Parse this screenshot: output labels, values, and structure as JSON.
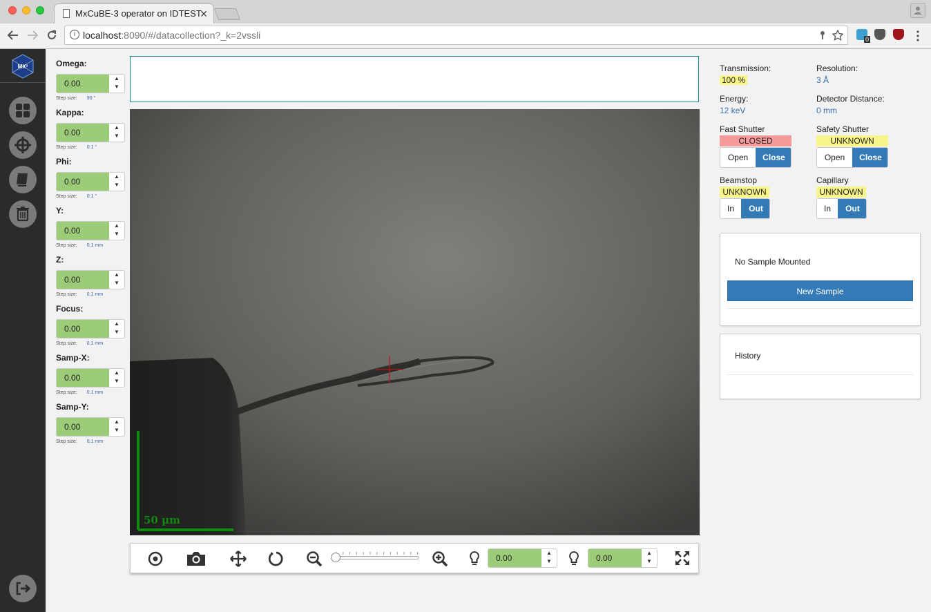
{
  "browser": {
    "tab_title": "MxCuBE-3 operator on IDTEST",
    "tab_close": "✕",
    "url_host": "localhost",
    "url_rest": ":8090/#/datacollection?_k=2vssli",
    "ext_badge": "0"
  },
  "sidebar": {
    "logo_text": "MX³",
    "items": [
      "dashboard",
      "centring",
      "logbook",
      "remove",
      "sign-out"
    ]
  },
  "motors": [
    {
      "label": "Omega:",
      "value": "0.00",
      "step_label": "Step size:",
      "step_value": "90 °"
    },
    {
      "label": "Kappa:",
      "value": "0.00",
      "step_label": "Step size:",
      "step_value": "0.1 °"
    },
    {
      "label": "Phi:",
      "value": "0.00",
      "step_label": "Step size:",
      "step_value": "0.1 °"
    },
    {
      "label": "Y:",
      "value": "0.00",
      "step_label": "Step size:",
      "step_value": "0.1 mm"
    },
    {
      "label": "Z:",
      "value": "0.00",
      "step_label": "Step size:",
      "step_value": "0.1 mm"
    },
    {
      "label": "Focus:",
      "value": "0.00",
      "step_label": "Step size:",
      "step_value": "0.1 mm"
    },
    {
      "label": "Samp-X:",
      "value": "0.00",
      "step_label": "Step size:",
      "step_value": "0.1 mm"
    },
    {
      "label": "Samp-Y:",
      "value": "0.00",
      "step_label": "Step size:",
      "step_value": "0.1 mm"
    }
  ],
  "video": {
    "scale_label": "50 µm"
  },
  "toolbar": {
    "light1_value": "0.00",
    "light2_value": "0.00",
    "zoom_level": 0
  },
  "status": {
    "transmission": {
      "label": "Transmission:",
      "value": "100 %"
    },
    "resolution": {
      "label": "Resolution:",
      "value": "3 Å"
    },
    "energy": {
      "label": "Energy:",
      "value": "12 keV"
    },
    "detector_distance": {
      "label": "Detector Distance:",
      "value": "0 mm"
    },
    "fast_shutter": {
      "label": "Fast Shutter",
      "state": "CLOSED",
      "open": "Open",
      "close": "Close"
    },
    "safety_shutter": {
      "label": "Safety Shutter",
      "state": "UNKNOWN",
      "open": "Open",
      "close": "Close"
    },
    "beamstop": {
      "label": "Beamstop",
      "state": "UNKNOWN",
      "in": "In",
      "out": "Out"
    },
    "capillary": {
      "label": "Capillary",
      "state": "UNKNOWN",
      "in": "In",
      "out": "Out"
    }
  },
  "sample_panel": {
    "text": "No Sample Mounted",
    "button": "New Sample"
  },
  "history_panel": {
    "title": "History"
  },
  "colors": {
    "accent": "#337ab7",
    "input_green": "#9ccc78",
    "closed_red": "#f59a9a",
    "unknown_yellow": "#f8f58a",
    "scale_green": "#0f8a0f"
  }
}
